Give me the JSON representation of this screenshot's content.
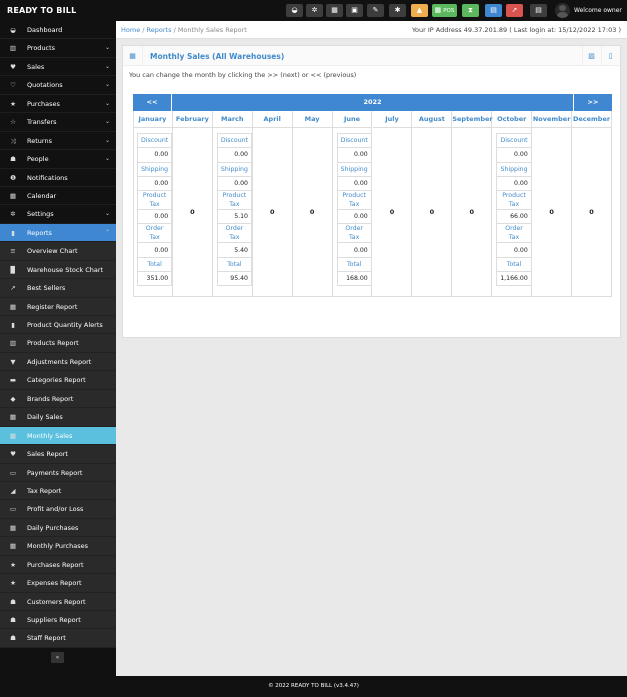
{
  "app": {
    "brand": "READY TO BILL",
    "welcome": "Welcome owner"
  },
  "topbar": {
    "pos_label": "POS",
    "buttons": [
      {
        "name": "dashboard-icon",
        "glyph": "◒",
        "color": "#3d3d3d"
      },
      {
        "name": "settings-icon",
        "glyph": "✲",
        "color": "#3d3d3d"
      },
      {
        "name": "calculator-icon",
        "glyph": "▦",
        "color": "#3d3d3d"
      },
      {
        "name": "calendar-icon",
        "glyph": "▣",
        "color": "#3d3d3d"
      },
      {
        "name": "edit-icon",
        "glyph": "✎",
        "color": "#3d3d3d"
      },
      {
        "name": "flag-icon",
        "glyph": "✱",
        "color": "#3d3d3d"
      },
      {
        "name": "alert-icon",
        "glyph": "▲",
        "color": "#f0ad4e"
      },
      {
        "name": "pos-icon",
        "glyph": "▦",
        "color": "#5cb85c"
      },
      {
        "name": "hourglass-icon",
        "glyph": "⧗",
        "color": "#5cb85c"
      },
      {
        "name": "list-icon",
        "glyph": "▤",
        "color": "#3f88d1"
      },
      {
        "name": "cart-icon",
        "glyph": "➚",
        "color": "#d9534f"
      },
      {
        "name": "menu-icon",
        "glyph": "▤",
        "color": "#3d3d3d"
      }
    ]
  },
  "breadcrumb": {
    "home": "Home",
    "reports": "Reports",
    "current": "Monthly Sales Report",
    "ip_info": "Your IP Address 49.37.201.89 ( Last login at: 15/12/2022 17:03 )"
  },
  "sidebar": {
    "items": [
      {
        "label": "Dashboard",
        "icon": "dashboard-icon",
        "glyph": "◒",
        "chev": ""
      },
      {
        "label": "Products",
        "icon": "barcode-icon",
        "glyph": "▥",
        "chev": "⌄"
      },
      {
        "label": "Sales",
        "icon": "heart-icon",
        "glyph": "♥",
        "chev": "⌄"
      },
      {
        "label": "Quotations",
        "icon": "heart-outline-icon",
        "glyph": "♡",
        "chev": "⌄"
      },
      {
        "label": "Purchases",
        "icon": "star-icon",
        "glyph": "★",
        "chev": "⌄"
      },
      {
        "label": "Transfers",
        "icon": "star-outline-icon",
        "glyph": "☆",
        "chev": "⌄"
      },
      {
        "label": "Returns",
        "icon": "random-icon",
        "glyph": "⤨",
        "chev": "⌄"
      },
      {
        "label": "People",
        "icon": "users-icon",
        "glyph": "☗",
        "chev": "⌄"
      },
      {
        "label": "Notifications",
        "icon": "info-icon",
        "glyph": "❶",
        "chev": ""
      },
      {
        "label": "Calendar",
        "icon": "calendar-icon",
        "glyph": "▦",
        "chev": ""
      },
      {
        "label": "Settings",
        "icon": "cog-icon",
        "glyph": "✲",
        "chev": "⌄"
      },
      {
        "label": "Reports",
        "icon": "bar-chart-icon",
        "glyph": "▮",
        "chev": "⌃"
      }
    ],
    "report_items": [
      {
        "label": "Overview Chart",
        "icon": "bars-icon",
        "glyph": "≡"
      },
      {
        "label": "Warehouse Stock Chart",
        "icon": "building-icon",
        "glyph": "▉"
      },
      {
        "label": "Best Sellers",
        "icon": "line-chart-icon",
        "glyph": "↗"
      },
      {
        "label": "Register Report",
        "icon": "th-icon",
        "glyph": "▦"
      },
      {
        "label": "Product Quantity Alerts",
        "icon": "bar-chart-icon",
        "glyph": "▮"
      },
      {
        "label": "Products Report",
        "icon": "barcode-icon",
        "glyph": "▥"
      },
      {
        "label": "Adjustments Report",
        "icon": "filter-icon",
        "glyph": "▼"
      },
      {
        "label": "Categories Report",
        "icon": "folder-icon",
        "glyph": "▬"
      },
      {
        "label": "Brands Report",
        "icon": "cubes-icon",
        "glyph": "◆"
      },
      {
        "label": "Daily Sales",
        "icon": "calendar-icon",
        "glyph": "▦"
      },
      {
        "label": "Monthly Sales",
        "icon": "calendar-icon",
        "glyph": "▦"
      },
      {
        "label": "Sales Report",
        "icon": "heart-icon",
        "glyph": "♥"
      },
      {
        "label": "Payments Report",
        "icon": "money-icon",
        "glyph": "▭"
      },
      {
        "label": "Tax Report",
        "icon": "area-chart-icon",
        "glyph": "◢"
      },
      {
        "label": "Profit and/or Loss",
        "icon": "money-icon",
        "glyph": "▭"
      },
      {
        "label": "Daily Purchases",
        "icon": "calendar-icon",
        "glyph": "▦"
      },
      {
        "label": "Monthly Purchases",
        "icon": "calendar-icon",
        "glyph": "▦"
      },
      {
        "label": "Purchases Report",
        "icon": "star-icon",
        "glyph": "★"
      },
      {
        "label": "Expenses Report",
        "icon": "star-icon",
        "glyph": "★"
      },
      {
        "label": "Customers Report",
        "icon": "users-icon",
        "glyph": "☗"
      },
      {
        "label": "Suppliers Report",
        "icon": "users-icon",
        "glyph": "☗"
      },
      {
        "label": "Staff Report",
        "icon": "users-icon",
        "glyph": "☗"
      }
    ],
    "active_item": "Monthly Sales",
    "collapse_glyph": "«"
  },
  "panel": {
    "title": "Monthly Sales (All Warehouses)",
    "note": "You can change the month by clicking the >> (next) or << (previous)"
  },
  "calendar": {
    "prev": "<<",
    "next": ">>",
    "year": "2022",
    "labels": {
      "discount": "Discount",
      "shipping": "Shipping",
      "product_tax": "Product Tax",
      "order_tax": "Order Tax",
      "total": "Total"
    },
    "months": [
      {
        "name": "January",
        "has_data": true,
        "discount": "0.00",
        "shipping": "0.00",
        "product_tax": "0.00",
        "order_tax": "0.00",
        "total": "351.00"
      },
      {
        "name": "February",
        "has_data": false,
        "value": "0"
      },
      {
        "name": "March",
        "has_data": true,
        "discount": "0.00",
        "shipping": "0.00",
        "product_tax": "5.10",
        "order_tax": "5.40",
        "total": "95.40"
      },
      {
        "name": "April",
        "has_data": false,
        "value": "0"
      },
      {
        "name": "May",
        "has_data": false,
        "value": "0"
      },
      {
        "name": "June",
        "has_data": true,
        "discount": "0.00",
        "shipping": "0.00",
        "product_tax": "0.00",
        "order_tax": "0.00",
        "total": "168.00"
      },
      {
        "name": "July",
        "has_data": false,
        "value": "0"
      },
      {
        "name": "August",
        "has_data": false,
        "value": "0"
      },
      {
        "name": "September",
        "has_data": false,
        "value": "0"
      },
      {
        "name": "October",
        "has_data": true,
        "discount": "0.00",
        "shipping": "0.00",
        "product_tax": "66.00",
        "order_tax": "0.00",
        "total": "1,166.00"
      },
      {
        "name": "November",
        "has_data": false,
        "value": "0"
      },
      {
        "name": "December",
        "has_data": false,
        "value": "0"
      }
    ]
  },
  "footer": {
    "text": "© 2022 READY TO BILL (v3.4.47)"
  }
}
